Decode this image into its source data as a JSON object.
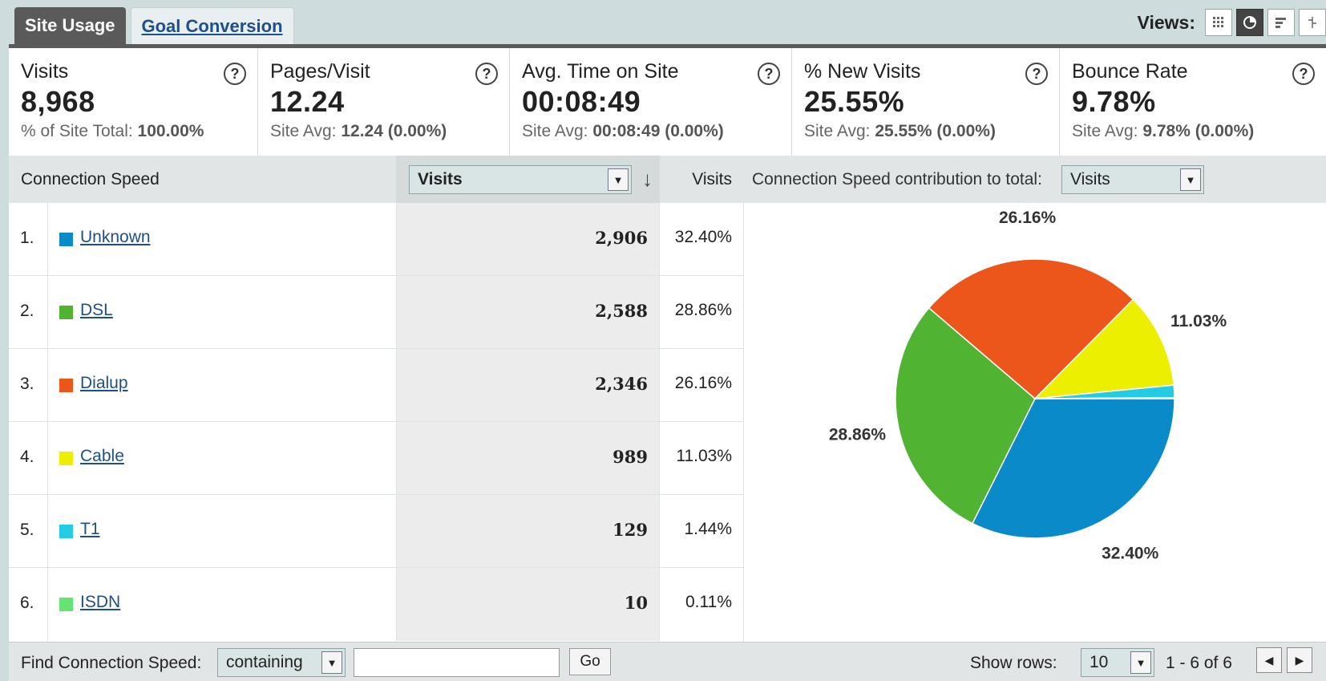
{
  "tabs": [
    {
      "label": "Site Usage",
      "active": true
    },
    {
      "label": "Goal Conversion",
      "active": false
    }
  ],
  "views": {
    "label": "Views:"
  },
  "scorecards": [
    {
      "label": "Visits",
      "value": "8,968",
      "sub_prefix": "% of Site Total: ",
      "sub_value": "100.00%"
    },
    {
      "label": "Pages/Visit",
      "value": "12.24",
      "sub_prefix": "Site Avg: ",
      "sub_value": "12.24 (0.00%)"
    },
    {
      "label": "Avg. Time on Site",
      "value": "00:08:49",
      "sub_prefix": "Site Avg: ",
      "sub_value": "00:08:49 (0.00%)"
    },
    {
      "label": "% New Visits",
      "value": "25.55%",
      "sub_prefix": "Site Avg: ",
      "sub_value": "25.55% (0.00%)"
    },
    {
      "label": "Bounce Rate",
      "value": "9.78%",
      "sub_prefix": "Site Avg: ",
      "sub_value": "9.78% (0.00%)"
    }
  ],
  "help_glyph": "?",
  "table": {
    "dimension_header": "Connection Speed",
    "metric_select": "Visits",
    "pct_header": "Visits",
    "contrib_label": "Connection Speed contribution to total:",
    "contrib_select": "Visits",
    "rows": [
      {
        "index": "1.",
        "name": "Unknown",
        "visits": "2,906",
        "pct": "32.40%",
        "color": "#0a8ac9"
      },
      {
        "index": "2.",
        "name": "DSL",
        "visits": "2,588",
        "pct": "28.86%",
        "color": "#50b432"
      },
      {
        "index": "3.",
        "name": "Dialup",
        "visits": "2,346",
        "pct": "26.16%",
        "color": "#ed561b"
      },
      {
        "index": "4.",
        "name": "Cable",
        "visits": "989",
        "pct": "11.03%",
        "color": "#edef00"
      },
      {
        "index": "5.",
        "name": "T1",
        "visits": "129",
        "pct": "1.44%",
        "color": "#24cbe5"
      },
      {
        "index": "6.",
        "name": "ISDN",
        "visits": "10",
        "pct": "0.11%",
        "color": "#64e572"
      }
    ]
  },
  "chart_data": {
    "type": "pie",
    "slices": [
      {
        "label": "Unknown",
        "value": 32.4,
        "color": "#0a8ac9",
        "data_label": "32.40%"
      },
      {
        "label": "DSL",
        "value": 28.86,
        "color": "#50b432",
        "data_label": "28.86%"
      },
      {
        "label": "Dialup",
        "value": 26.16,
        "color": "#ed561b",
        "data_label": "26.16%"
      },
      {
        "label": "Cable",
        "value": 11.03,
        "color": "#edef00",
        "data_label": "11.03%"
      },
      {
        "label": "T1",
        "value": 1.44,
        "color": "#24cbe5",
        "data_label": ""
      },
      {
        "label": "ISDN",
        "value": 0.11,
        "color": "#64e572",
        "data_label": ""
      }
    ]
  },
  "footer": {
    "find_label": "Find Connection Speed:",
    "match_select": "containing",
    "search_value": "",
    "go_label": "Go",
    "show_rows_label": "Show rows:",
    "rows_select": "10",
    "range": "1 - 6 of 6"
  }
}
